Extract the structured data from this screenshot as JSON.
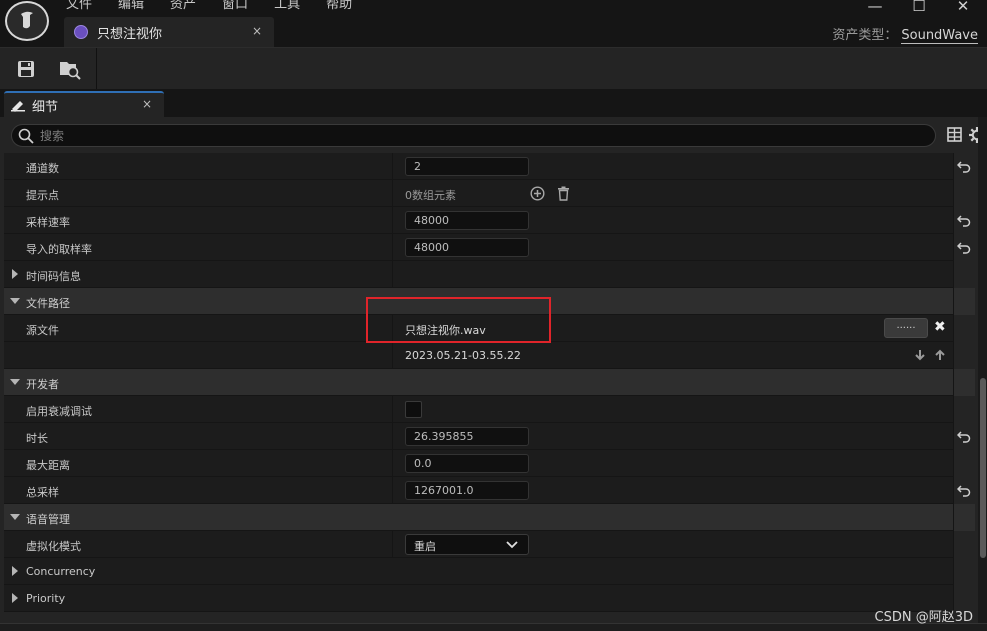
{
  "menu": [
    "文件",
    "编辑",
    "资产",
    "窗口",
    "工具",
    "帮助"
  ],
  "asset_tab": {
    "title": "只想注视你",
    "close_glyph": "×"
  },
  "asset_type": {
    "label": "资产类型：",
    "value": "SoundWave"
  },
  "window_controls": {
    "minimize": "—",
    "maximize": "☐",
    "close": "✕"
  },
  "details_tab": {
    "label": "细节",
    "close_glyph": "×"
  },
  "search": {
    "placeholder": "搜索"
  },
  "properties": {
    "channels": {
      "label": "通道数",
      "value": "2"
    },
    "cue_points": {
      "label": "提示点",
      "value": "0数组元素"
    },
    "sample_rate": {
      "label": "采样速率",
      "value": "48000"
    },
    "import_sample_rate": {
      "label": "导入的取样率",
      "value": "48000"
    },
    "timecode": {
      "label": "时间码信息"
    },
    "file_path": {
      "label": "文件路径"
    },
    "source_file": {
      "label": "源文件",
      "value": "只想注视你.wav",
      "timestamp": "2023.05.21-03.55.22",
      "browse": "......"
    },
    "developer": {
      "label": "开发者"
    },
    "attenuation_debug": {
      "label": "启用衰减调试"
    },
    "duration": {
      "label": "时长",
      "value": "26.395855"
    },
    "max_distance": {
      "label": "最大距离",
      "value": "0.0"
    },
    "total_samples": {
      "label": "总采样",
      "value": "1267001.0"
    },
    "voice_management": {
      "label": "语音管理"
    },
    "virtualization_mode": {
      "label": "虚拟化模式",
      "value": "重启"
    },
    "concurrency": {
      "label": "Concurrency"
    },
    "priority": {
      "label": "Priority"
    }
  },
  "watermark": "CSDN @阿赵3D",
  "colors": {
    "accent": "#2f6fb5",
    "highlight_box": "#e0242a",
    "asset_icon": "#6a4fbf"
  }
}
